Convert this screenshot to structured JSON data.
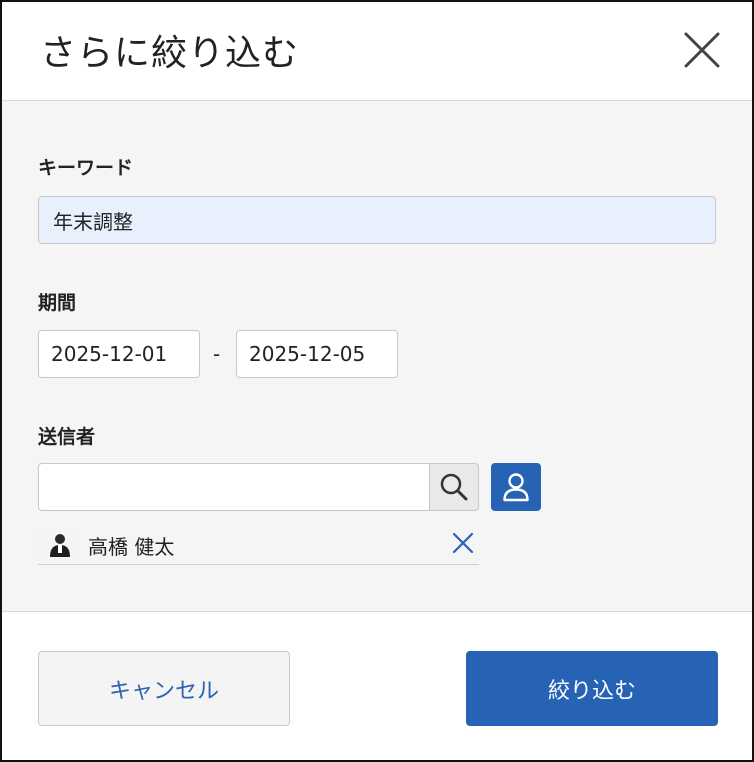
{
  "dialog": {
    "title": "さらに絞り込む",
    "close_icon": "close-icon"
  },
  "keyword": {
    "label": "キーワード",
    "value": "年末調整"
  },
  "period": {
    "label": "期間",
    "start": "2025-12-01",
    "separator": "-",
    "end": "2025-12-05"
  },
  "sender": {
    "label": "送信者",
    "value": "",
    "search_icon": "search-icon",
    "user_icon": "user-icon",
    "selected": [
      {
        "name": "高橋 健太",
        "remove_icon": "close-icon"
      }
    ]
  },
  "footer": {
    "cancel_label": "キャンセル",
    "apply_label": "絞り込む"
  },
  "colors": {
    "primary": "#2763b5",
    "keyword_bg": "#e8f0fe",
    "body_bg": "#f5f5f5"
  }
}
